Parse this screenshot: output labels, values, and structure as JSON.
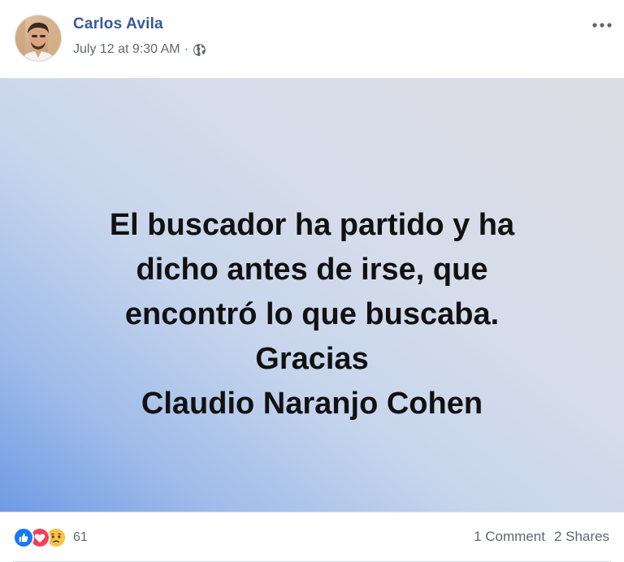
{
  "post": {
    "author_name": "Carlos Avila",
    "timestamp": "July 12 at 9:30 AM",
    "separator": "·",
    "privacy_icon": "globe-icon",
    "more_icon": "more-options-icon",
    "status_lines": [
      "El buscador ha partido y ha",
      "dicho antes de irse, que",
      "encontró lo que buscaba.",
      "Gracias",
      "Claudio Naranjo Cohen"
    ],
    "background_colors": [
      "#6f9be4",
      "#c6d5ec",
      "#dcdde4"
    ]
  },
  "footer": {
    "reactions": [
      {
        "type": "like",
        "icon": "like-reaction-icon",
        "color": "#1877f2"
      },
      {
        "type": "love",
        "icon": "love-reaction-icon",
        "color": "#f33e58"
      },
      {
        "type": "sad",
        "icon": "sad-reaction-icon",
        "color": "#f7b125"
      }
    ],
    "reaction_count": "61",
    "comments_label": "1 Comment",
    "shares_label": "2 Shares"
  },
  "colors": {
    "author_link": "#385898",
    "meta_text": "#606770"
  }
}
